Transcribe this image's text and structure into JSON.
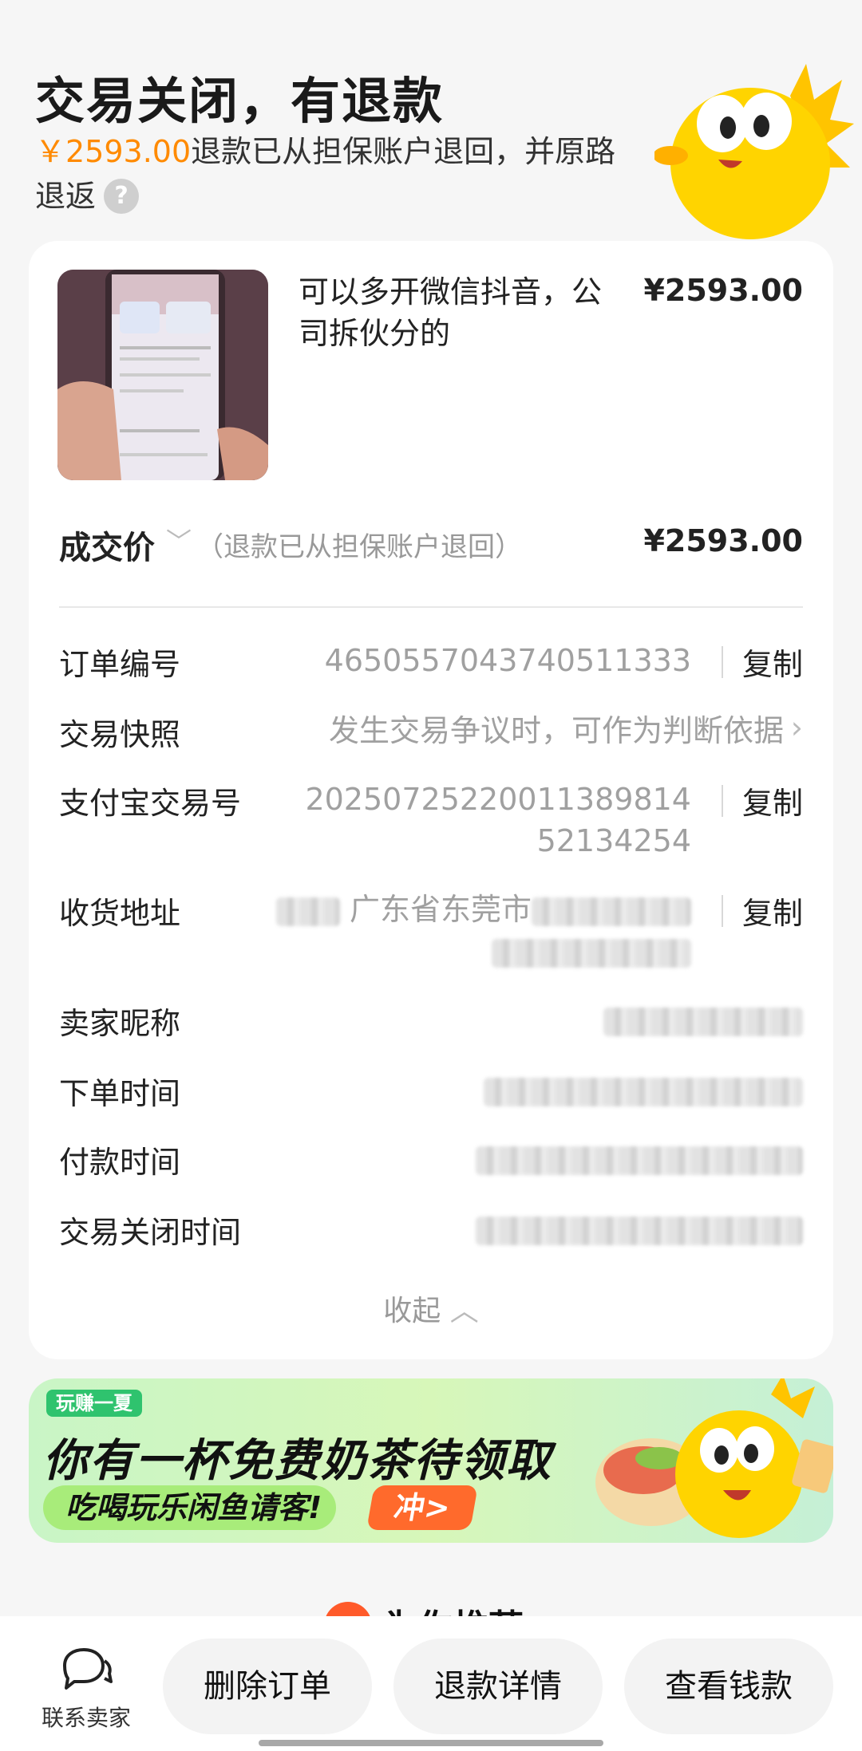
{
  "header": {
    "title": "交易关闭，有退款",
    "refund_amount": "￥2593.00",
    "refund_text": "退款已从担保账户退回，并原路退返",
    "help": "?"
  },
  "product": {
    "title": "可以多开微信抖音，公司拆伙分的",
    "price": "¥2593.00"
  },
  "deal": {
    "label": "成交价",
    "note": "（退款已从担保账户退回）",
    "price": "¥2593.00"
  },
  "details": {
    "order_no_label": "订单编号",
    "order_no": "4650557043740511333",
    "snapshot_label": "交易快照",
    "snapshot_value": "发生交易争议时，可作为判断依据",
    "alipay_label": "支付宝交易号",
    "alipay_line1": "202507252200113898​14",
    "alipay_line2": "52134254",
    "address_label": "收货地址",
    "address_visible": "广东省东莞市",
    "seller_label": "卖家昵称",
    "order_time_label": "下单时间",
    "pay_time_label": "付款时间",
    "close_time_label": "交易关闭时间",
    "copy": "复制",
    "collapse": "收起"
  },
  "banner": {
    "tag": "玩赚一夏",
    "title": "你有一杯免费奶茶待领取",
    "subtitle": "吃喝玩乐闲鱼请客!",
    "go": "冲>"
  },
  "recommend": {
    "label": "为你推荐"
  },
  "bottom": {
    "contact": "联系卖家",
    "delete": "删除订单",
    "refund_detail": "退款详情",
    "view_money": "查看钱款"
  },
  "colors": {
    "accent": "#ff8a00",
    "mascot": "#ffd400"
  }
}
